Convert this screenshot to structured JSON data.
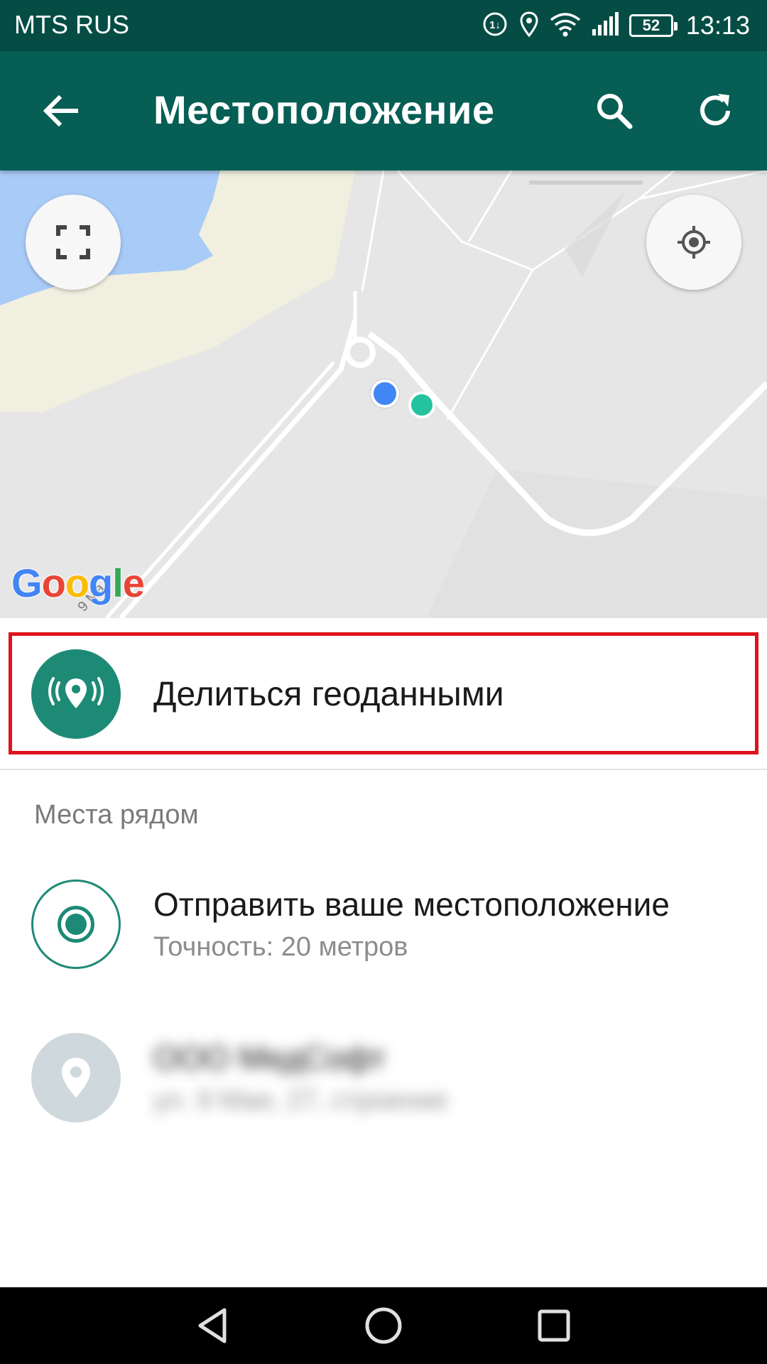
{
  "status_bar": {
    "carrier": "MTS RUS",
    "battery": "52",
    "time": "13:13"
  },
  "app_bar": {
    "title": "Местоположение"
  },
  "map": {
    "attribution": "Google",
    "street_label": "9 Ма"
  },
  "share_live": {
    "label": "Делиться геоданными"
  },
  "nearby": {
    "header": "Места рядом",
    "send_location": {
      "title": "Отправить ваше местоположение",
      "subtitle": "Точность: 20 метров"
    },
    "place": {
      "title": "ООО МедСофт",
      "subtitle": "ул. 9 Мая, 27, строение"
    }
  },
  "colors": {
    "status_bar": "#054d44",
    "app_bar": "#075e54",
    "accent": "#1d8a76",
    "highlight": "#e0121b",
    "my_location_dot": "#4285f4",
    "selected_dot": "#25c2a0"
  }
}
